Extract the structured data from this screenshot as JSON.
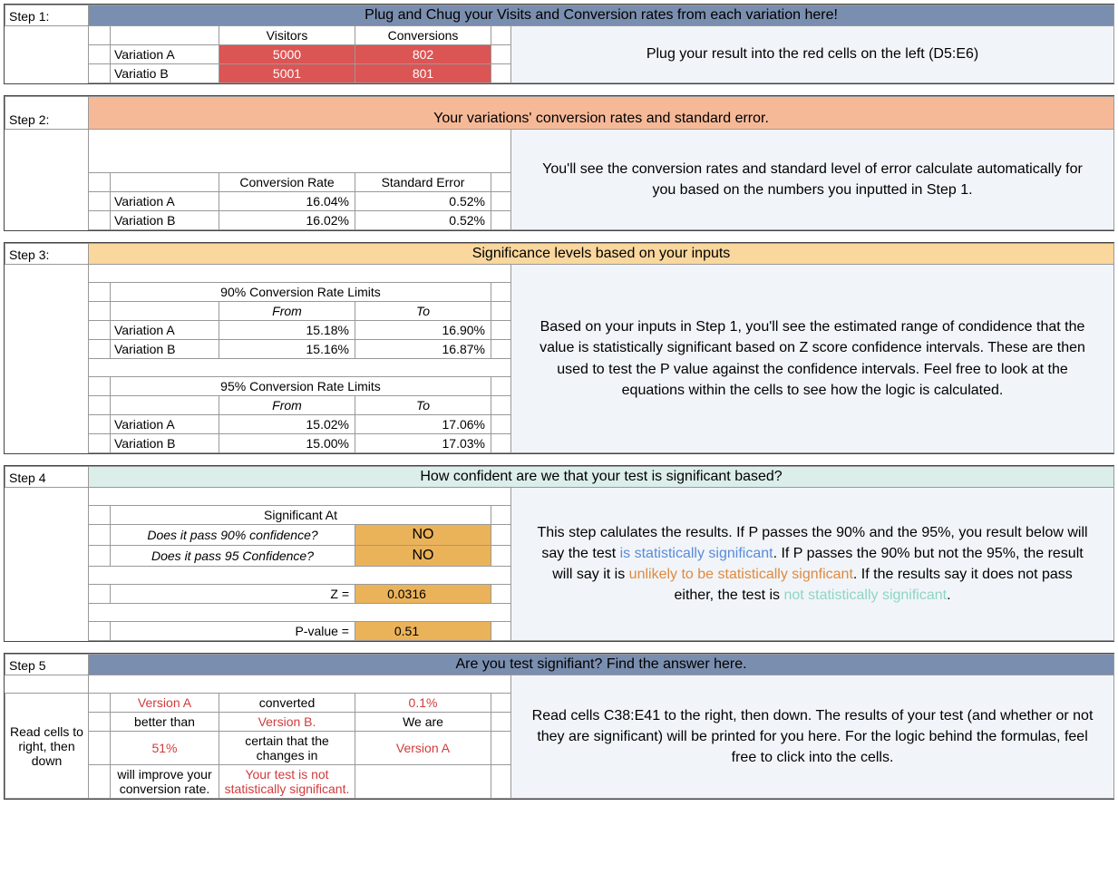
{
  "step1": {
    "label": "Step 1:",
    "header": "Plug and Chug your Visits and Conversion rates from each variation here!",
    "col1": "Visitors",
    "col2": "Conversions",
    "rowA": "Variation A",
    "rowB": "Variatio B",
    "a_v": "5000",
    "a_c": "802",
    "b_v": "5001",
    "b_c": "801",
    "info": "Plug your result into the red cells on the left (D5:E6)"
  },
  "step2": {
    "label": "Step 2:",
    "header": "Your variations' conversion rates and standard error.",
    "col1": "Conversion Rate",
    "col2": "Standard Error",
    "rowA": "Variation A",
    "rowB": "Variation B",
    "a_cr": "16.04%",
    "a_se": "0.52%",
    "b_cr": "16.02%",
    "b_se": "0.52%",
    "info": "You'll see the conversion rates and standard level of error calculate automatically for you based on the numbers you inputted in Step 1."
  },
  "step3": {
    "label": "Step 3:",
    "header": "Significance levels based on your inputs",
    "t90": "90% Conversion Rate Limits",
    "t95": "95% Conversion Rate Limits",
    "from": "From",
    "to": "To",
    "rowA": "Variation A",
    "rowB": "Variation B",
    "a90f": "15.18%",
    "a90t": "16.90%",
    "b90f": "15.16%",
    "b90t": "16.87%",
    "a95f": "15.02%",
    "a95t": "17.06%",
    "b95f": "15.00%",
    "b95t": "17.03%",
    "info": "Based on your inputs in Step 1, you'll see the estimated range of condidence that the value is statistically significant based on Z score confidence intervals. These are then used to test the P value against the confidence intervals. Feel free to look at the equations within the cells to see how the logic is calculated."
  },
  "step4": {
    "label": "Step 4",
    "header": "How confident are we that your test is significant based?",
    "sigat": "Significant At",
    "q90": "Does it pass 90% confidence?",
    "q95": "Does it pass 95 Confidence?",
    "no": "NO",
    "zlabel": "Z =",
    "z": "0.0316",
    "plabel": "P-value =",
    "p": "0.51",
    "info_pre": "This step calulates the results. If P passes the 90% and the 95%, you result below will say the test ",
    "info_sig": "is statistically significant",
    "info_mid1": ". If P passes the 90% but not the 95%, the result will say it is ",
    "info_unl": "unlikely to be statistically signficant",
    "info_mid2": ". If the results say it does not pass either, the test is ",
    "info_not": "not statistically significant",
    "info_end": "."
  },
  "step5": {
    "label": "Step 5",
    "header": "Are you test signifiant? Find the answer here.",
    "side": "Read cells to right, then down",
    "r1c1": "Version A",
    "r1c2": "converted",
    "r1c3": "0.1%",
    "r2c1": "better than",
    "r2c2": "Version B.",
    "r2c3": "We are",
    "r3c1": "51%",
    "r3c2": "certain that the changes in",
    "r3c3": "Version A",
    "r4c1": "will improve your conversion rate.",
    "r4c2": "Your test is not statistically significant.",
    "info": "Read cells C38:E41 to the right, then down. The results of your test (and whether or not they are significant) will be printed for you here. For the logic behind the formulas, feel free to click into the cells."
  }
}
